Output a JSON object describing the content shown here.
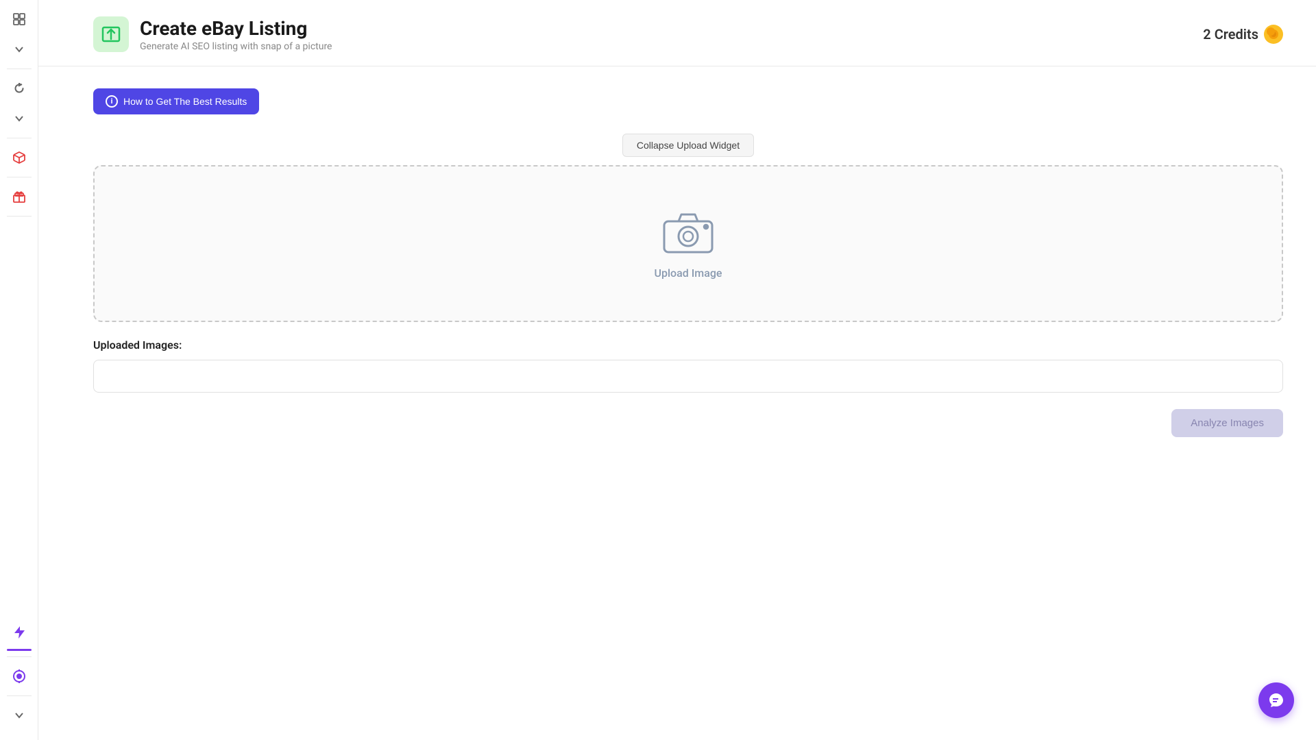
{
  "sidebar": {
    "icons": [
      {
        "name": "layout-icon",
        "symbol": "⊞",
        "active": false
      },
      {
        "name": "chevron-down-icon",
        "symbol": "⌄",
        "active": false
      },
      {
        "name": "refresh-icon",
        "symbol": "↺",
        "active": false,
        "color": "normal"
      },
      {
        "name": "chevron-down-2-icon",
        "symbol": "⌄",
        "active": false
      },
      {
        "name": "box-icon",
        "symbol": "◈",
        "active": false,
        "color": "red"
      },
      {
        "name": "gift-icon",
        "symbol": "🎁",
        "active": false,
        "color": "red"
      },
      {
        "name": "lightning-icon",
        "symbol": "⚡",
        "active": false,
        "color": "purple"
      },
      {
        "name": "credits-icon",
        "symbol": "◉",
        "active": false,
        "color": "purple"
      },
      {
        "name": "chevron-down-3-icon",
        "symbol": "⌄",
        "active": false
      }
    ]
  },
  "header": {
    "title": "Create eBay Listing",
    "subtitle": "Generate AI SEO listing with snap of a picture",
    "credits_label": "2 Credits"
  },
  "how_to": {
    "label": "How to Get The Best Results"
  },
  "upload_widget": {
    "collapse_label": "Collapse Upload Widget",
    "upload_image_label": "Upload Image"
  },
  "uploaded_images": {
    "section_title": "Uploaded Images:"
  },
  "analyze": {
    "button_label": "Analyze Images"
  },
  "chat": {
    "label": "chat-support"
  }
}
